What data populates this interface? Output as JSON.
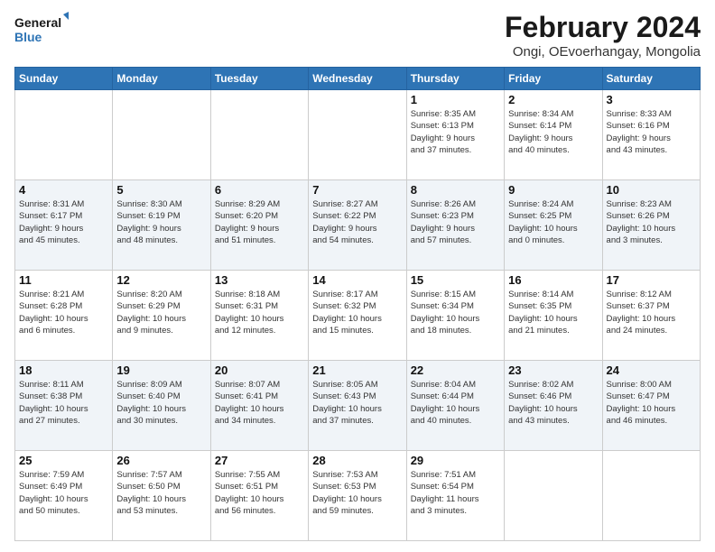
{
  "logo": {
    "line1": "General",
    "line2": "Blue"
  },
  "title": "February 2024",
  "subtitle": "Ongi, OEvoerhangay, Mongolia",
  "weekdays": [
    "Sunday",
    "Monday",
    "Tuesday",
    "Wednesday",
    "Thursday",
    "Friday",
    "Saturday"
  ],
  "weeks": [
    [
      {
        "day": "",
        "info": ""
      },
      {
        "day": "",
        "info": ""
      },
      {
        "day": "",
        "info": ""
      },
      {
        "day": "",
        "info": ""
      },
      {
        "day": "1",
        "info": "Sunrise: 8:35 AM\nSunset: 6:13 PM\nDaylight: 9 hours\nand 37 minutes."
      },
      {
        "day": "2",
        "info": "Sunrise: 8:34 AM\nSunset: 6:14 PM\nDaylight: 9 hours\nand 40 minutes."
      },
      {
        "day": "3",
        "info": "Sunrise: 8:33 AM\nSunset: 6:16 PM\nDaylight: 9 hours\nand 43 minutes."
      }
    ],
    [
      {
        "day": "4",
        "info": "Sunrise: 8:31 AM\nSunset: 6:17 PM\nDaylight: 9 hours\nand 45 minutes."
      },
      {
        "day": "5",
        "info": "Sunrise: 8:30 AM\nSunset: 6:19 PM\nDaylight: 9 hours\nand 48 minutes."
      },
      {
        "day": "6",
        "info": "Sunrise: 8:29 AM\nSunset: 6:20 PM\nDaylight: 9 hours\nand 51 minutes."
      },
      {
        "day": "7",
        "info": "Sunrise: 8:27 AM\nSunset: 6:22 PM\nDaylight: 9 hours\nand 54 minutes."
      },
      {
        "day": "8",
        "info": "Sunrise: 8:26 AM\nSunset: 6:23 PM\nDaylight: 9 hours\nand 57 minutes."
      },
      {
        "day": "9",
        "info": "Sunrise: 8:24 AM\nSunset: 6:25 PM\nDaylight: 10 hours\nand 0 minutes."
      },
      {
        "day": "10",
        "info": "Sunrise: 8:23 AM\nSunset: 6:26 PM\nDaylight: 10 hours\nand 3 minutes."
      }
    ],
    [
      {
        "day": "11",
        "info": "Sunrise: 8:21 AM\nSunset: 6:28 PM\nDaylight: 10 hours\nand 6 minutes."
      },
      {
        "day": "12",
        "info": "Sunrise: 8:20 AM\nSunset: 6:29 PM\nDaylight: 10 hours\nand 9 minutes."
      },
      {
        "day": "13",
        "info": "Sunrise: 8:18 AM\nSunset: 6:31 PM\nDaylight: 10 hours\nand 12 minutes."
      },
      {
        "day": "14",
        "info": "Sunrise: 8:17 AM\nSunset: 6:32 PM\nDaylight: 10 hours\nand 15 minutes."
      },
      {
        "day": "15",
        "info": "Sunrise: 8:15 AM\nSunset: 6:34 PM\nDaylight: 10 hours\nand 18 minutes."
      },
      {
        "day": "16",
        "info": "Sunrise: 8:14 AM\nSunset: 6:35 PM\nDaylight: 10 hours\nand 21 minutes."
      },
      {
        "day": "17",
        "info": "Sunrise: 8:12 AM\nSunset: 6:37 PM\nDaylight: 10 hours\nand 24 minutes."
      }
    ],
    [
      {
        "day": "18",
        "info": "Sunrise: 8:11 AM\nSunset: 6:38 PM\nDaylight: 10 hours\nand 27 minutes."
      },
      {
        "day": "19",
        "info": "Sunrise: 8:09 AM\nSunset: 6:40 PM\nDaylight: 10 hours\nand 30 minutes."
      },
      {
        "day": "20",
        "info": "Sunrise: 8:07 AM\nSunset: 6:41 PM\nDaylight: 10 hours\nand 34 minutes."
      },
      {
        "day": "21",
        "info": "Sunrise: 8:05 AM\nSunset: 6:43 PM\nDaylight: 10 hours\nand 37 minutes."
      },
      {
        "day": "22",
        "info": "Sunrise: 8:04 AM\nSunset: 6:44 PM\nDaylight: 10 hours\nand 40 minutes."
      },
      {
        "day": "23",
        "info": "Sunrise: 8:02 AM\nSunset: 6:46 PM\nDaylight: 10 hours\nand 43 minutes."
      },
      {
        "day": "24",
        "info": "Sunrise: 8:00 AM\nSunset: 6:47 PM\nDaylight: 10 hours\nand 46 minutes."
      }
    ],
    [
      {
        "day": "25",
        "info": "Sunrise: 7:59 AM\nSunset: 6:49 PM\nDaylight: 10 hours\nand 50 minutes."
      },
      {
        "day": "26",
        "info": "Sunrise: 7:57 AM\nSunset: 6:50 PM\nDaylight: 10 hours\nand 53 minutes."
      },
      {
        "day": "27",
        "info": "Sunrise: 7:55 AM\nSunset: 6:51 PM\nDaylight: 10 hours\nand 56 minutes."
      },
      {
        "day": "28",
        "info": "Sunrise: 7:53 AM\nSunset: 6:53 PM\nDaylight: 10 hours\nand 59 minutes."
      },
      {
        "day": "29",
        "info": "Sunrise: 7:51 AM\nSunset: 6:54 PM\nDaylight: 11 hours\nand 3 minutes."
      },
      {
        "day": "",
        "info": ""
      },
      {
        "day": "",
        "info": ""
      }
    ]
  ]
}
